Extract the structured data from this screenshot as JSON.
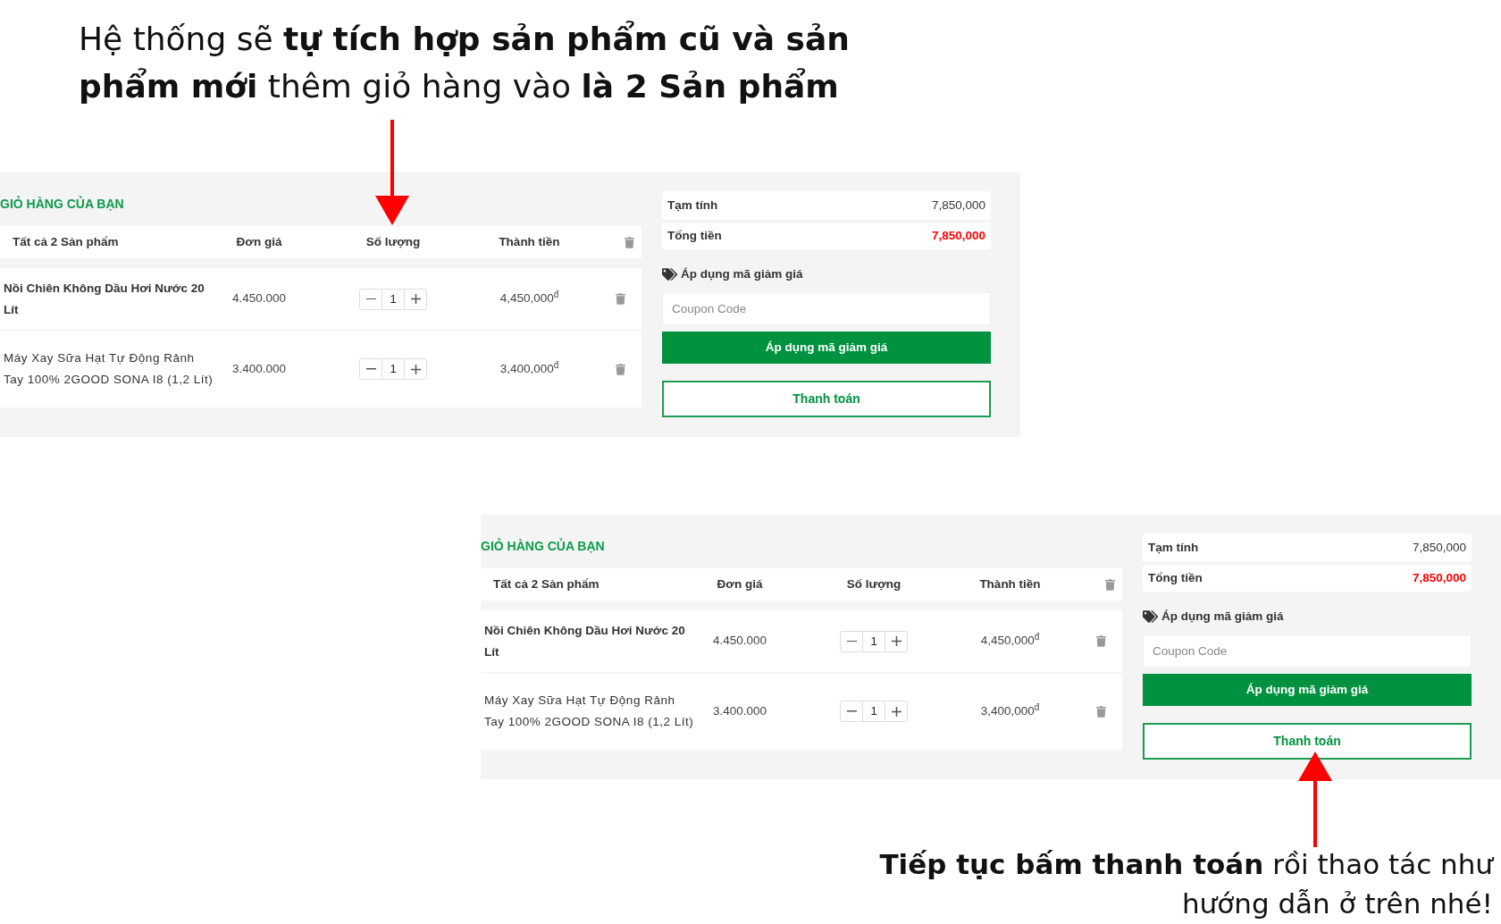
{
  "instruction_top": "Hệ thống sẽ **tự tích hợp sản phẩm cũ và sản phẩm mới** thêm giỏ hàng vào **là 2 Sản phẩm**",
  "carts": [
    {
      "title": "GIỎ HÀNG CỦA BẠN",
      "columns": [
        "Tất cả 2 Sản phẩm",
        "Đơn giá",
        "Số lượng",
        "Thành tiền"
      ],
      "items": [
        {
          "name": "Nồi Chiên Không Dầu Hơi Nước 20 Lít",
          "bold": true,
          "unit_price": "4.450.000",
          "quantity": "1",
          "total": "4,450,000$^{đ}$"
        },
        {
          "name": "Máy Xay Sữa Hạt Tự Động Rảnh Tay 100% 2GOOD SONA I8 (1,2 Lít)",
          "bold": false,
          "unit_price": "3.400.000",
          "quantity": "1",
          "total": "3,400,000$^{đ}$"
        }
      ],
      "summary": [
        {
          "kind": "subtotal",
          "label": "Tạm tính",
          "value": "7,850,000"
        },
        {
          "kind": "total",
          "label": "Tổng tiền",
          "value": "7,850,000"
        }
      ],
      "coupon": {
        "label": "Áp dụng mã giảm giá",
        "placeholder": "Coupon Code",
        "button": "Áp dụng mã giảm giá"
      },
      "checkout_button": "Thanh toán"
    },
    {
      "title": "GIỎ HÀNG CỦA BẠN",
      "columns": [
        "Tất cả 2 Sản phẩm",
        "Đơn giá",
        "Số lượng",
        "Thành tiền"
      ],
      "items": [
        {
          "name": "Nồi Chiên Không Dầu Hơi Nước 20 Lít",
          "bold": true,
          "unit_price": "4.450.000",
          "quantity": "1",
          "total": "4,450,000$^{đ}$"
        },
        {
          "name": "Máy Xay Sữa Hạt Tự Động Rảnh Tay 100% 2GOOD SONA I8 (1,2 Lít)",
          "bold": false,
          "unit_price": "3.400.000",
          "quantity": "1",
          "total": "3,400,000$^{đ}$"
        }
      ],
      "summary": [
        {
          "kind": "subtotal",
          "label": "Tạm tính",
          "value": "7,850,000"
        },
        {
          "kind": "total",
          "label": "Tổng tiền",
          "value": "7,850,000"
        }
      ],
      "coupon": {
        "label": "Áp dụng mã giảm giá",
        "placeholder": "Coupon Code",
        "button": "Áp dụng mã giảm giá"
      },
      "checkout_button": "Thanh toán"
    }
  ],
  "instruction_bottom": "**Tiếp tục bấm thanh toán** rồi thao tác như hướng dẫn ở trên nhé!"
}
